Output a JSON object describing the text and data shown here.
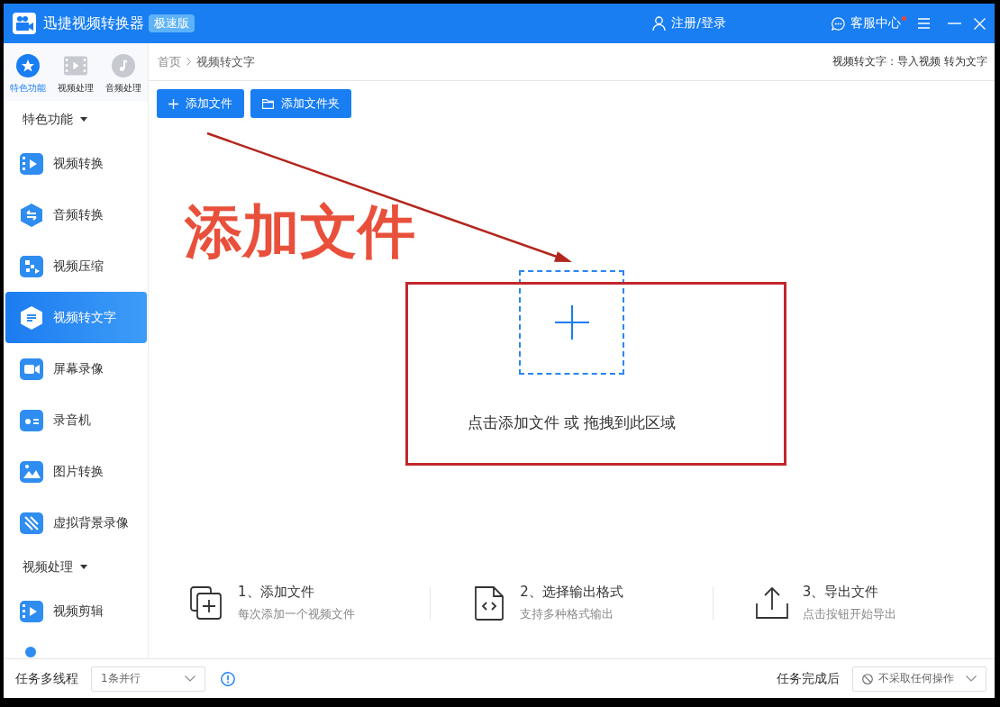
{
  "window": {
    "title": "迅捷视频转换器",
    "edition_badge": "极速版"
  },
  "title_bar": {
    "login": "注册/登录",
    "support": "客服中心",
    "support_unread": true
  },
  "sidebar": {
    "tabs": [
      {
        "label": "特色功能",
        "selected": true
      },
      {
        "label": "视频处理",
        "selected": false
      },
      {
        "label": "音频处理",
        "selected": false
      }
    ],
    "sections": [
      {
        "label": "特色功能",
        "expanded": true,
        "items": [
          {
            "label": "视频转换",
            "selected": false
          },
          {
            "label": "音频转换",
            "selected": false
          },
          {
            "label": "视频压缩",
            "selected": false
          },
          {
            "label": "视频转文字",
            "selected": true
          },
          {
            "label": "屏幕录像",
            "selected": false
          },
          {
            "label": "录音机",
            "selected": false
          },
          {
            "label": "图片转换",
            "selected": false
          },
          {
            "label": "虚拟背景录像",
            "selected": false
          }
        ]
      },
      {
        "label": "视频处理",
        "expanded": true,
        "items": [
          {
            "label": "视频剪辑",
            "selected": false
          }
        ]
      }
    ]
  },
  "breadcrumb": [
    "首页",
    "视频转文字"
  ],
  "page_hint": "视频转文字：导入视频 转为文字",
  "toolbar": {
    "buttons": [
      {
        "kind": "file",
        "label": "添加文件"
      },
      {
        "kind": "folder",
        "label": "添加文件夹"
      }
    ]
  },
  "annotation": {
    "label": "添加文件"
  },
  "drop_zone": {
    "hint": "点击添加文件 或 拖拽到此区域"
  },
  "steps": [
    {
      "title": "1、添加文件",
      "subtitle": "每次添加一个视频文件"
    },
    {
      "title": "2、选择输出格式",
      "subtitle": "支持多种格式输出"
    },
    {
      "title": "3、导出文件",
      "subtitle": "点击按钮开始导出"
    }
  ],
  "status_bar": {
    "threads_label": "任务多线程",
    "threads_value": "1条并行",
    "after_label": "任务完成后",
    "after_value": "不采取任何操作"
  }
}
